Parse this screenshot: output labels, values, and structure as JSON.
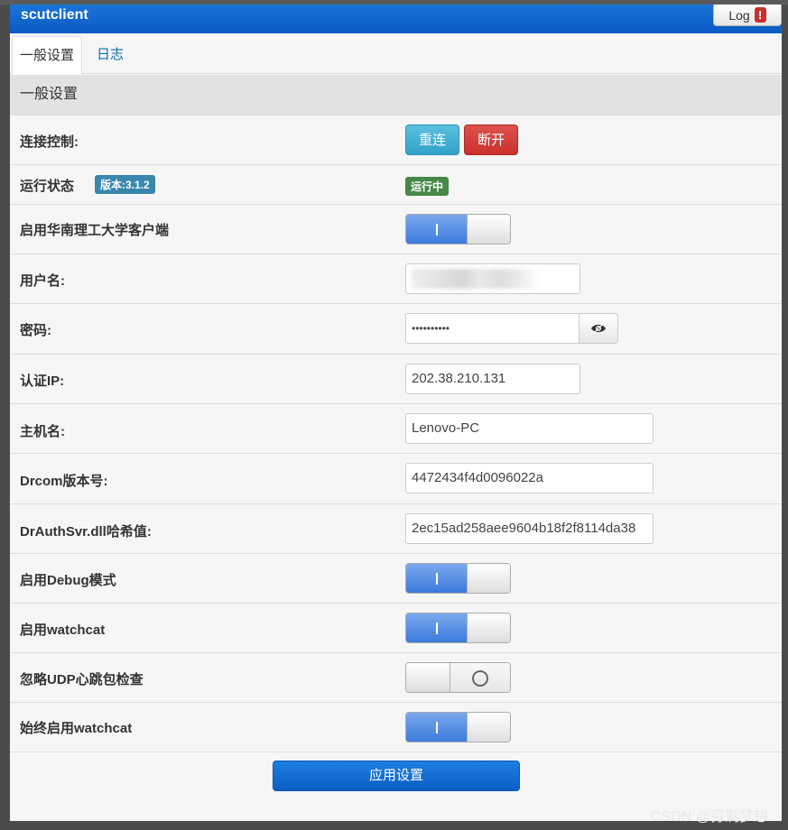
{
  "window": {
    "title": "scutclient",
    "log_label": "Log",
    "log_badge": "!"
  },
  "tabs": [
    {
      "label": "一般设置"
    },
    {
      "label": "日志"
    }
  ],
  "section": {
    "title": "一般设置"
  },
  "rows": {
    "connect": {
      "label": "连接控制:",
      "reconnect": "重连",
      "disconnect": "断开"
    },
    "status": {
      "label": "运行状态",
      "version": "版本:3.1.2",
      "running": "运行中"
    },
    "enable_client": {
      "label": "启用华南理工大学客户端",
      "state": "on"
    },
    "username": {
      "label": "用户名:",
      "value": ""
    },
    "password": {
      "label": "密码:",
      "value": "••••••••••"
    },
    "auth_ip": {
      "label": "认证IP:",
      "value": "202.38.210.131"
    },
    "hostname": {
      "label": "主机名:",
      "value": "Lenovo-PC"
    },
    "drcom_version": {
      "label": "Drcom版本号:",
      "value": "4472434f4d0096022a"
    },
    "dll_hash": {
      "label": "DrAuthSvr.dll哈希值:",
      "value": "2ec15ad258aee9604b18f2f8114da38"
    },
    "debug": {
      "label": "启用Debug模式",
      "state": "on"
    },
    "watchcat": {
      "label": "启用watchcat",
      "state": "on"
    },
    "ignore_udp": {
      "label": "忽略UDP心跳包检查",
      "state": "off"
    },
    "always_watchcat": {
      "label": "始终启用watchcat",
      "state": "on"
    }
  },
  "apply": {
    "label": "应用设置"
  },
  "watermark": "CSDN @穷剩梦想",
  "colors": {
    "titlebar": "#0a5bc3",
    "accent_blue": "#3b7bde",
    "danger": "#c9302c",
    "success": "#468847",
    "info": "#3a87ad"
  }
}
